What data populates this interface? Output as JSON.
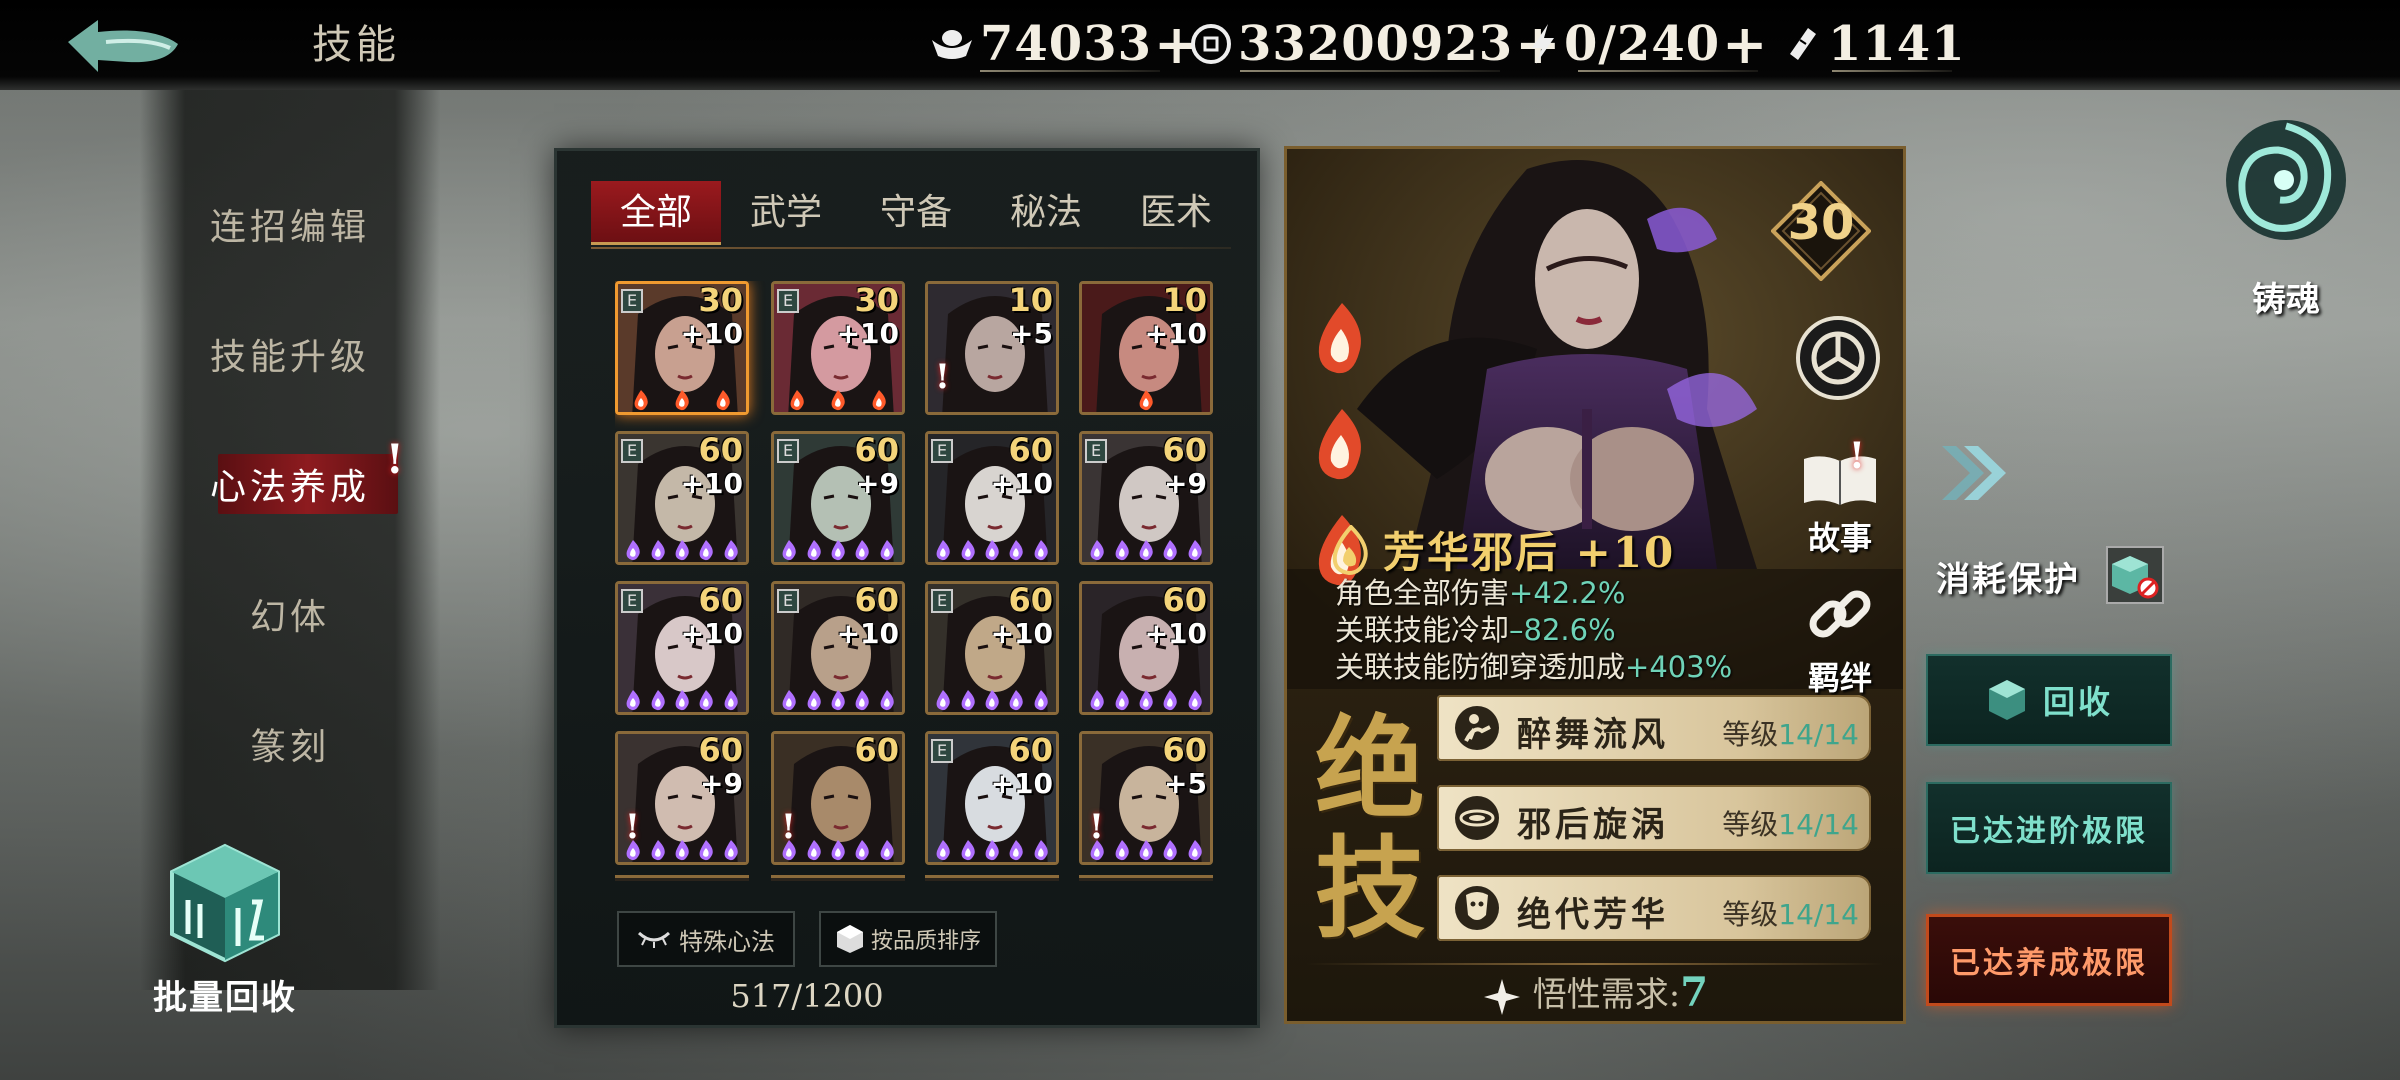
{
  "header": {
    "title": "技能",
    "resources": [
      {
        "icon": "silver-ingot-icon",
        "value": "74033",
        "plus": true
      },
      {
        "icon": "coin-icon",
        "value": "33200923",
        "plus": true
      },
      {
        "icon": "stamina-lightning-icon",
        "value": "0/240",
        "plus": true
      },
      {
        "icon": "ticket-icon",
        "value": "1141",
        "plus": false
      }
    ]
  },
  "sidebar": {
    "items": [
      {
        "label": "连招编辑"
      },
      {
        "label": "技能升级"
      },
      {
        "label": "心法养成",
        "active": true,
        "alert": "!"
      },
      {
        "label": "幻体"
      },
      {
        "label": "篆刻"
      }
    ],
    "batch_recycle": "批量回收"
  },
  "tabs": [
    {
      "label": "全部",
      "active": true
    },
    {
      "label": "武学"
    },
    {
      "label": "守备"
    },
    {
      "label": "秘法"
    },
    {
      "label": "医术"
    }
  ],
  "cards": [
    {
      "level": "30",
      "plus": "+10",
      "e": true,
      "flames": 3,
      "flame_color": "orange",
      "highlight": true,
      "warn": false
    },
    {
      "level": "30",
      "plus": "+10",
      "e": true,
      "flames": 3,
      "flame_color": "orange",
      "highlight": false,
      "warn": false
    },
    {
      "level": "10",
      "plus": "+5",
      "e": false,
      "flames": 0,
      "flame_color": "orange",
      "highlight": false,
      "warn": true
    },
    {
      "level": "10",
      "plus": "+10",
      "e": false,
      "flames": 1,
      "flame_color": "orange",
      "highlight": false,
      "warn": false
    },
    {
      "level": "60",
      "plus": "+10",
      "e": true,
      "flames": 5,
      "flame_color": "purple",
      "highlight": false,
      "warn": false
    },
    {
      "level": "60",
      "plus": "+9",
      "e": true,
      "flames": 5,
      "flame_color": "purple",
      "highlight": false,
      "warn": false
    },
    {
      "level": "60",
      "plus": "+10",
      "e": true,
      "flames": 5,
      "flame_color": "purple",
      "highlight": false,
      "warn": false
    },
    {
      "level": "60",
      "plus": "+9",
      "e": true,
      "flames": 5,
      "flame_color": "purple",
      "highlight": false,
      "warn": false
    },
    {
      "level": "60",
      "plus": "+10",
      "e": true,
      "flames": 5,
      "flame_color": "purple",
      "highlight": false,
      "warn": false
    },
    {
      "level": "60",
      "plus": "+10",
      "e": true,
      "flames": 5,
      "flame_color": "purple",
      "highlight": false,
      "warn": false
    },
    {
      "level": "60",
      "plus": "+10",
      "e": true,
      "flames": 5,
      "flame_color": "purple",
      "highlight": false,
      "warn": false
    },
    {
      "level": "60",
      "plus": "+10",
      "e": false,
      "flames": 5,
      "flame_color": "purple",
      "highlight": false,
      "warn": false
    },
    {
      "level": "60",
      "plus": "+9",
      "e": false,
      "flames": 5,
      "flame_color": "purple",
      "highlight": false,
      "warn": true
    },
    {
      "level": "60",
      "plus": "",
      "e": false,
      "flames": 5,
      "flame_color": "purple",
      "highlight": false,
      "warn": true
    },
    {
      "level": "60",
      "plus": "+10",
      "e": true,
      "flames": 5,
      "flame_color": "purple",
      "highlight": false,
      "warn": false
    },
    {
      "level": "60",
      "plus": "+5",
      "e": false,
      "flames": 5,
      "flame_color": "purple",
      "highlight": false,
      "warn": true
    }
  ],
  "bottom": {
    "special_label": "特殊心法",
    "sort_label": "按品质排序",
    "capacity": "517/1200"
  },
  "detail": {
    "level": "30",
    "name": "芳华邪后 +10",
    "stats": [
      {
        "label": "角色全部伤害",
        "value": "+42.2%"
      },
      {
        "label": "关联技能冷却",
        "value": "–82.6%"
      },
      {
        "label": "关联技能防御穿透加成",
        "value": "+403%"
      }
    ],
    "story_label": "故事",
    "story_alert": "!",
    "bond_label": "羁绊",
    "section_label": "绝技",
    "skills": [
      {
        "icon": "dance-figure-icon",
        "name": "醉舞流风",
        "level_label": "等级",
        "level": "14/14"
      },
      {
        "icon": "vortex-icon",
        "name": "邪后旋涡",
        "level_label": "等级",
        "level": "14/14"
      },
      {
        "icon": "face-mask-icon",
        "name": "绝代芳华",
        "level_label": "等级",
        "level": "14/14"
      }
    ],
    "wisdom_label": "悟性需求:",
    "wisdom_value": "7"
  },
  "right": {
    "soul_label": "铸魂",
    "protect_label": "消耗保护",
    "recycle_label": "回收",
    "advance_max": "已达进阶极限",
    "cultivate_max": "已达养成极限"
  },
  "colors": {
    "accent_red": "#8d1b1f",
    "gold": "#f2cf6e",
    "teal": "#6fd3b8",
    "orange_glow": "#e07a20"
  }
}
